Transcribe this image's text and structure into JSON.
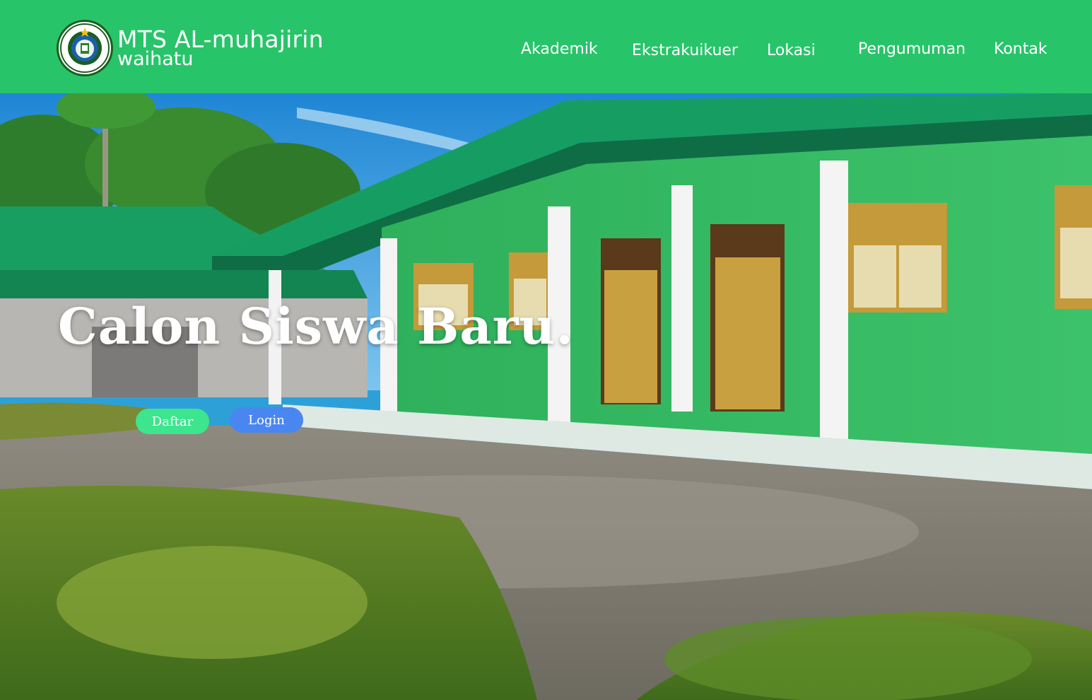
{
  "brand": {
    "line1": "MTS AL-muhajirin",
    "line2": "waihatu",
    "logo_icon": "school-emblem-icon",
    "logo_text_top": "YAYASAN AL-MUHAJIRIN WAIHATU",
    "logo_text_bottom": "KAIRATU BARAT"
  },
  "nav": {
    "items": [
      {
        "label": "Akademik"
      },
      {
        "label": "Ekstrakuikuer"
      },
      {
        "label": "Lokasi"
      },
      {
        "label": "Pengumuman"
      },
      {
        "label": "Kontak"
      }
    ]
  },
  "hero": {
    "title": "Calon Siswa Baru.",
    "daftar_label": "Daftar",
    "login_label": "Login",
    "background_description_icon": "school-building-photo"
  },
  "colors": {
    "navbar": "#28c46a",
    "daftar_button": "#3de58f",
    "login_button": "#4a86f0",
    "text": "#ffffff"
  }
}
